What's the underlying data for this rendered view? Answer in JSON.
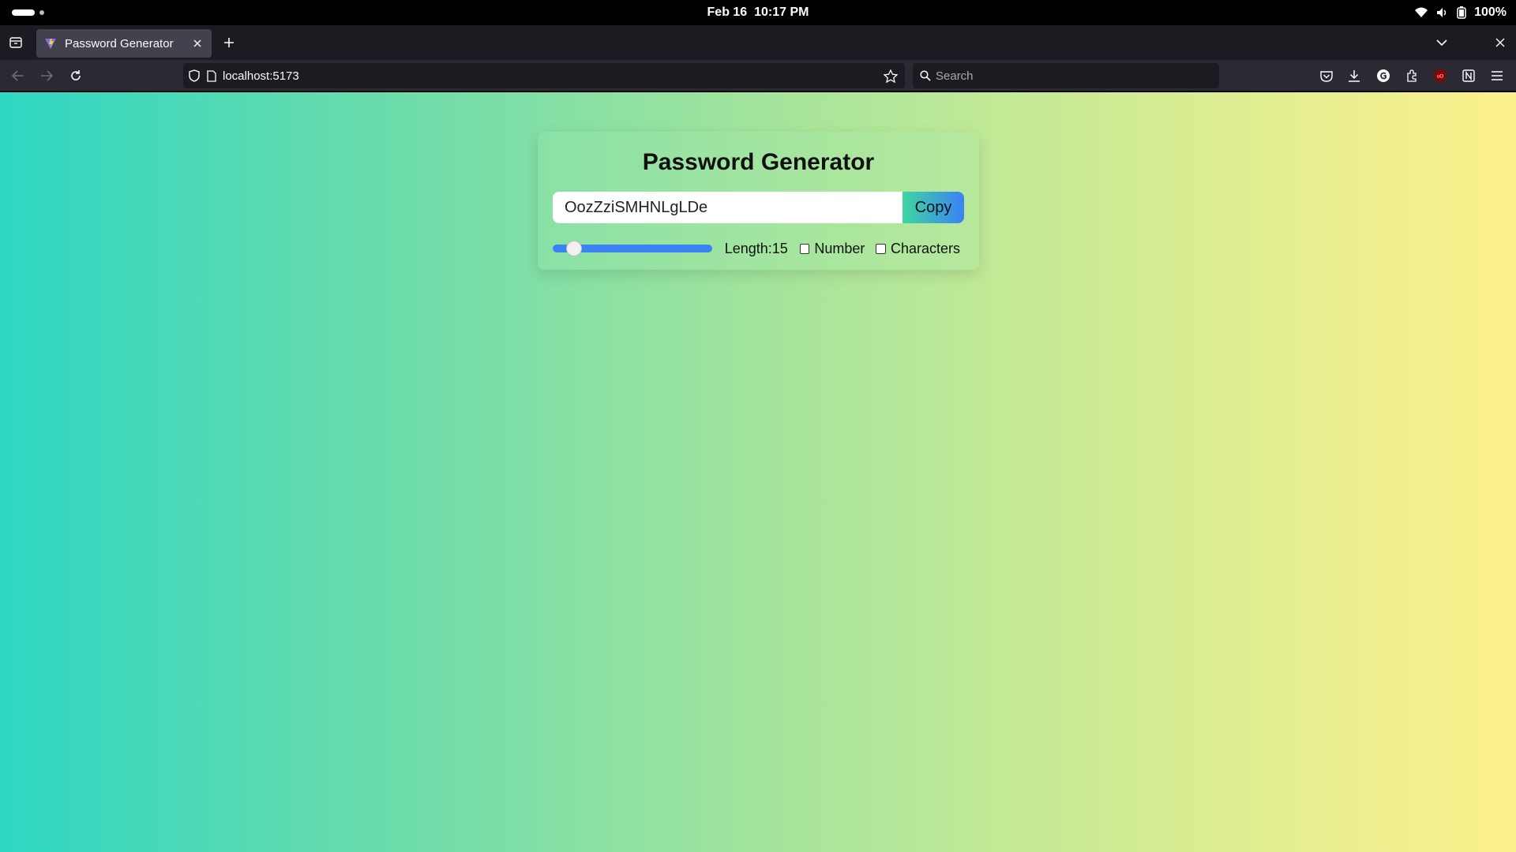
{
  "os": {
    "date": "Feb 16",
    "time": "10:17 PM",
    "battery": "100%",
    "icons": [
      "wifi-icon",
      "volume-icon",
      "battery-icon"
    ]
  },
  "browser": {
    "tab": {
      "title": "Password Generator",
      "favicon": "vite-logo-icon"
    },
    "url": "localhost:5173",
    "search_placeholder": "Search",
    "toolbar_icons": [
      "pocket-icon",
      "download-icon",
      "grammarly-icon",
      "extensions-icon",
      "ublock-icon",
      "notion-icon",
      "menu-icon"
    ]
  },
  "app": {
    "title": "Password Generator",
    "password": "OozZziSMHNLgLDe",
    "copy_label": "Copy",
    "length_label": "Length:15",
    "length": {
      "value": 15,
      "min": 6,
      "max": 100
    },
    "number_label": "Number",
    "number_checked": false,
    "characters_label": "Characters",
    "characters_checked": false,
    "colors": {
      "slider": "#3b82f6",
      "copy_from": "#3fd6a0",
      "copy_to": "#3b82f6"
    }
  }
}
